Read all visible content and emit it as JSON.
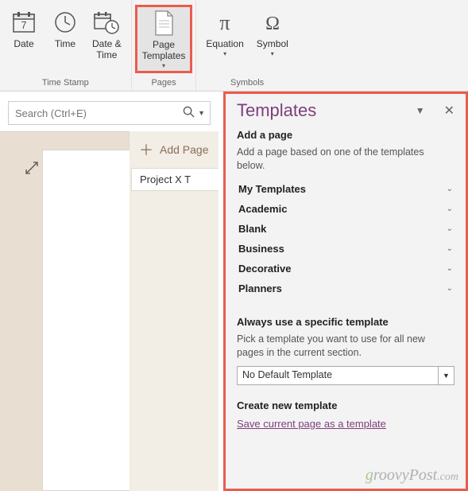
{
  "ribbon": {
    "date_label": "Date",
    "time_label": "Time",
    "datetime_label": "Date &\nTime",
    "page_templates_label": "Page\nTemplates",
    "equation_label": "Equation",
    "symbol_label": "Symbol",
    "group_timestamp": "Time Stamp",
    "group_pages": "Pages",
    "group_symbols": "Symbols"
  },
  "search": {
    "placeholder": "Search (Ctrl+E)"
  },
  "pages": {
    "add_page": "Add Page",
    "tab1": "Project X T"
  },
  "panel": {
    "title": "Templates",
    "add_page_head": "Add a page",
    "add_page_desc": "Add a page based on one of the templates below.",
    "categories": [
      "My Templates",
      "Academic",
      "Blank",
      "Business",
      "Decorative",
      "Planners"
    ],
    "always_head": "Always use a specific template",
    "always_desc": "Pick a template you want to use for all new pages in the current section.",
    "dropdown_value": "No Default Template",
    "create_head": "Create new template",
    "save_link": "Save current page as a template"
  },
  "watermark": "groovyPost.com"
}
